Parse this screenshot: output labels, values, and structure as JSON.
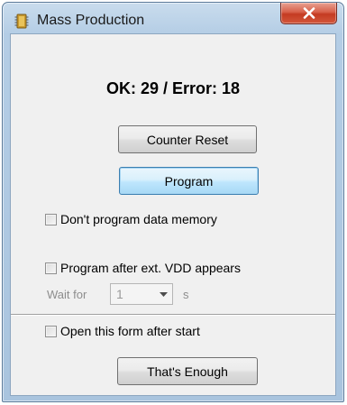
{
  "window": {
    "title": "Mass Production",
    "close_label": "X"
  },
  "status": {
    "text": "OK: 29 / Error: 18"
  },
  "buttons": {
    "counter_reset": "Counter Reset",
    "program": "Program",
    "thats_enough": "That's Enough"
  },
  "options": {
    "dont_program_data_memory": {
      "label": "Don't program data memory",
      "checked": false
    },
    "program_after_vdd": {
      "label": "Program after ext. VDD appears",
      "checked": false
    },
    "open_form_after_start": {
      "label": "Open this form after start",
      "checked": false
    }
  },
  "wait": {
    "label": "Wait for",
    "value": "1",
    "unit": "s",
    "enabled": false
  },
  "colors": {
    "titlebar": "#b4cde5",
    "close_button": "#c43b22",
    "focused_button_border": "#3c7fb1",
    "client_background": "#f0f0f0",
    "disabled_text": "#8d8d8d"
  },
  "icons": {
    "app": "chip-icon",
    "close": "close-icon",
    "combo_arrow": "chevron-down-icon"
  }
}
